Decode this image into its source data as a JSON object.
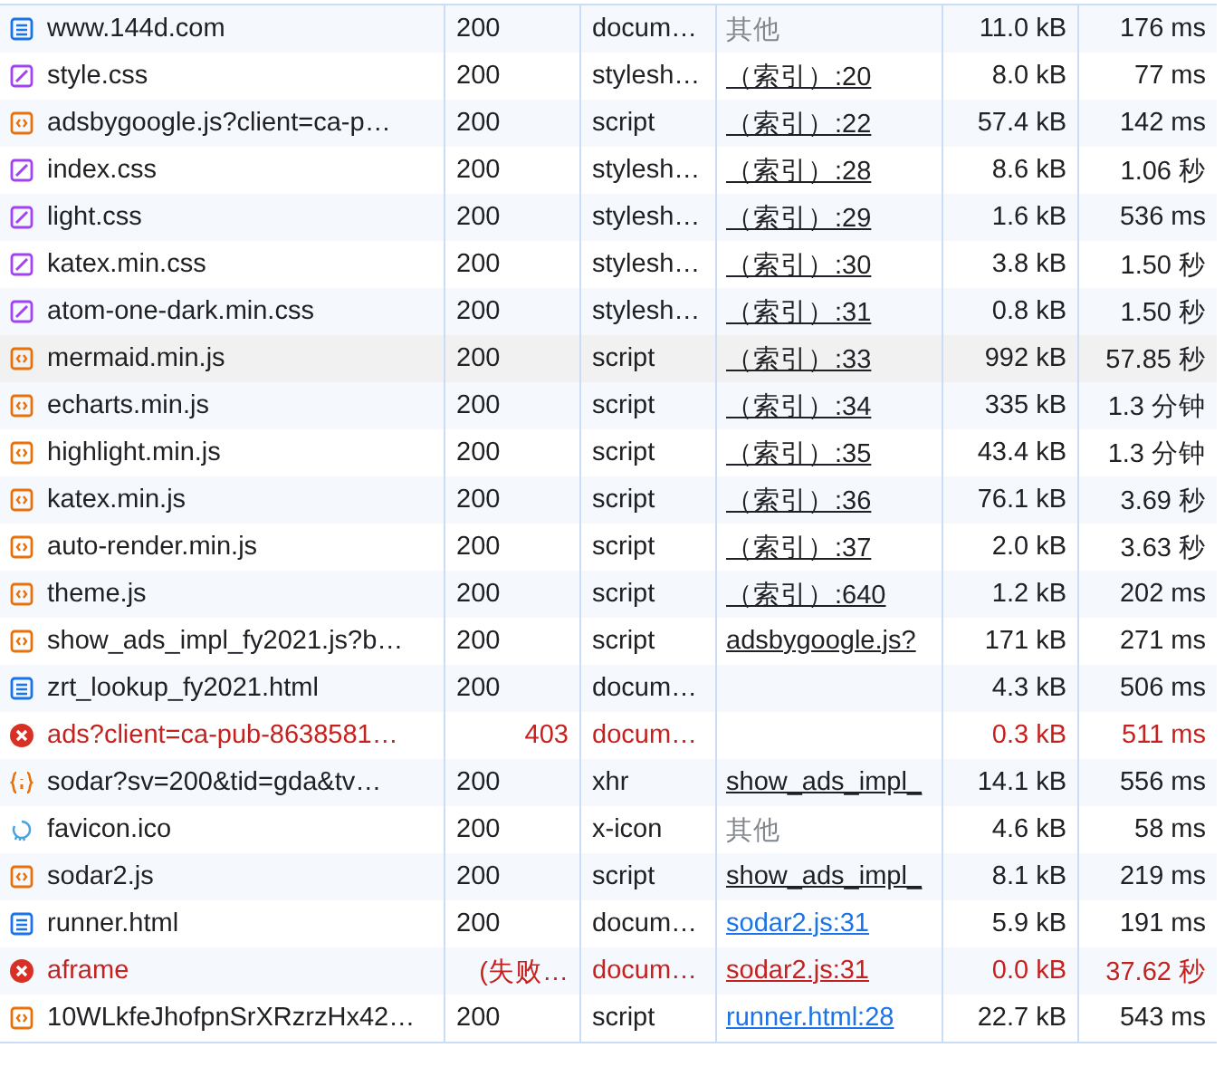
{
  "rows": [
    {
      "name": "www.144d.com",
      "kind": "doc",
      "status": "200",
      "type": "docum…",
      "initiator": {
        "kind": "other",
        "text": "其他"
      },
      "size": "11.0 kB",
      "time": "176 ms",
      "failed": false,
      "selected": false
    },
    {
      "name": "style.css",
      "kind": "style",
      "status": "200",
      "type": "stylesh…",
      "initiator": {
        "kind": "source",
        "text": "（索引）:20"
      },
      "size": "8.0 kB",
      "time": "77 ms",
      "failed": false,
      "selected": false
    },
    {
      "name": "adsbygoogle.js?client=ca-p…",
      "kind": "code",
      "status": "200",
      "type": "script",
      "initiator": {
        "kind": "source",
        "text": "（索引）:22"
      },
      "size": "57.4 kB",
      "time": "142 ms",
      "failed": false,
      "selected": false
    },
    {
      "name": "index.css",
      "kind": "style",
      "status": "200",
      "type": "stylesh…",
      "initiator": {
        "kind": "source",
        "text": "（索引）:28"
      },
      "size": "8.6 kB",
      "time": "1.06 秒",
      "failed": false,
      "selected": false
    },
    {
      "name": "light.css",
      "kind": "style",
      "status": "200",
      "type": "stylesh…",
      "initiator": {
        "kind": "source",
        "text": "（索引）:29"
      },
      "size": "1.6 kB",
      "time": "536 ms",
      "failed": false,
      "selected": false
    },
    {
      "name": "katex.min.css",
      "kind": "style",
      "status": "200",
      "type": "stylesh…",
      "initiator": {
        "kind": "source",
        "text": "（索引）:30"
      },
      "size": "3.8 kB",
      "time": "1.50 秒",
      "failed": false,
      "selected": false
    },
    {
      "name": "atom-one-dark.min.css",
      "kind": "style",
      "status": "200",
      "type": "stylesh…",
      "initiator": {
        "kind": "source",
        "text": "（索引）:31"
      },
      "size": "0.8 kB",
      "time": "1.50 秒",
      "failed": false,
      "selected": false
    },
    {
      "name": "mermaid.min.js",
      "kind": "code",
      "status": "200",
      "type": "script",
      "initiator": {
        "kind": "source",
        "text": "（索引）:33"
      },
      "size": "992 kB",
      "time": "57.85 秒",
      "failed": false,
      "selected": true
    },
    {
      "name": "echarts.min.js",
      "kind": "code",
      "status": "200",
      "type": "script",
      "initiator": {
        "kind": "source",
        "text": "（索引）:34"
      },
      "size": "335 kB",
      "time": "1.3 分钟",
      "failed": false,
      "selected": false
    },
    {
      "name": "highlight.min.js",
      "kind": "code",
      "status": "200",
      "type": "script",
      "initiator": {
        "kind": "source",
        "text": "（索引）:35"
      },
      "size": "43.4 kB",
      "time": "1.3 分钟",
      "failed": false,
      "selected": false
    },
    {
      "name": "katex.min.js",
      "kind": "code",
      "status": "200",
      "type": "script",
      "initiator": {
        "kind": "source",
        "text": "（索引）:36"
      },
      "size": "76.1 kB",
      "time": "3.69 秒",
      "failed": false,
      "selected": false
    },
    {
      "name": "auto-render.min.js",
      "kind": "code",
      "status": "200",
      "type": "script",
      "initiator": {
        "kind": "source",
        "text": "（索引）:37"
      },
      "size": "2.0 kB",
      "time": "3.63 秒",
      "failed": false,
      "selected": false
    },
    {
      "name": "theme.js",
      "kind": "code",
      "status": "200",
      "type": "script",
      "initiator": {
        "kind": "source",
        "text": "（索引）:640"
      },
      "size": "1.2 kB",
      "time": "202 ms",
      "failed": false,
      "selected": false
    },
    {
      "name": "show_ads_impl_fy2021.js?b…",
      "kind": "code",
      "status": "200",
      "type": "script",
      "initiator": {
        "kind": "source",
        "text": "adsbygoogle.js?"
      },
      "size": "171 kB",
      "time": "271 ms",
      "failed": false,
      "selected": false
    },
    {
      "name": "zrt_lookup_fy2021.html",
      "kind": "doc",
      "status": "200",
      "type": "docum…",
      "size": "4.3 kB",
      "time": "506 ms",
      "failed": false,
      "selected": false
    },
    {
      "name": "ads?client=ca-pub-8638581…",
      "kind": "error",
      "status": "403",
      "type": "docum…",
      "size": "0.3 kB",
      "time": "511 ms",
      "failed": true,
      "selected": false
    },
    {
      "name": "sodar?sv=200&tid=gda&tv…",
      "kind": "data",
      "status": "200",
      "type": "xhr",
      "initiator": {
        "kind": "source",
        "text": "show_ads_impl_"
      },
      "size": "14.1 kB",
      "time": "556 ms",
      "failed": false,
      "selected": false
    },
    {
      "name": "favicon.ico",
      "kind": "image",
      "status": "200",
      "type": "x-icon",
      "initiator": {
        "kind": "other",
        "text": "其他"
      },
      "size": "4.6 kB",
      "time": "58 ms",
      "failed": false,
      "selected": false
    },
    {
      "name": "sodar2.js",
      "kind": "code",
      "status": "200",
      "type": "script",
      "initiator": {
        "kind": "source",
        "text": "show_ads_impl_"
      },
      "size": "8.1 kB",
      "time": "219 ms",
      "failed": false,
      "selected": false
    },
    {
      "name": "runner.html",
      "kind": "doc",
      "status": "200",
      "type": "docum…",
      "initiator": {
        "kind": "link",
        "text": "sodar2.js:31"
      },
      "size": "5.9 kB",
      "time": "191 ms",
      "failed": false,
      "selected": false
    },
    {
      "name": "aframe",
      "kind": "error",
      "status": "(失败…",
      "type": "docum…",
      "initiator": {
        "kind": "link",
        "text": "sodar2.js:31"
      },
      "size": "0.0 kB",
      "time": "37.62 秒",
      "failed": true,
      "selected": false
    },
    {
      "name": "10WLkfeJhofpnSrXRzrzHx42…",
      "kind": "code",
      "status": "200",
      "type": "script",
      "initiator": {
        "kind": "link",
        "text": "runner.html:28"
      },
      "size": "22.7 kB",
      "time": "543 ms",
      "failed": false,
      "selected": false
    }
  ]
}
